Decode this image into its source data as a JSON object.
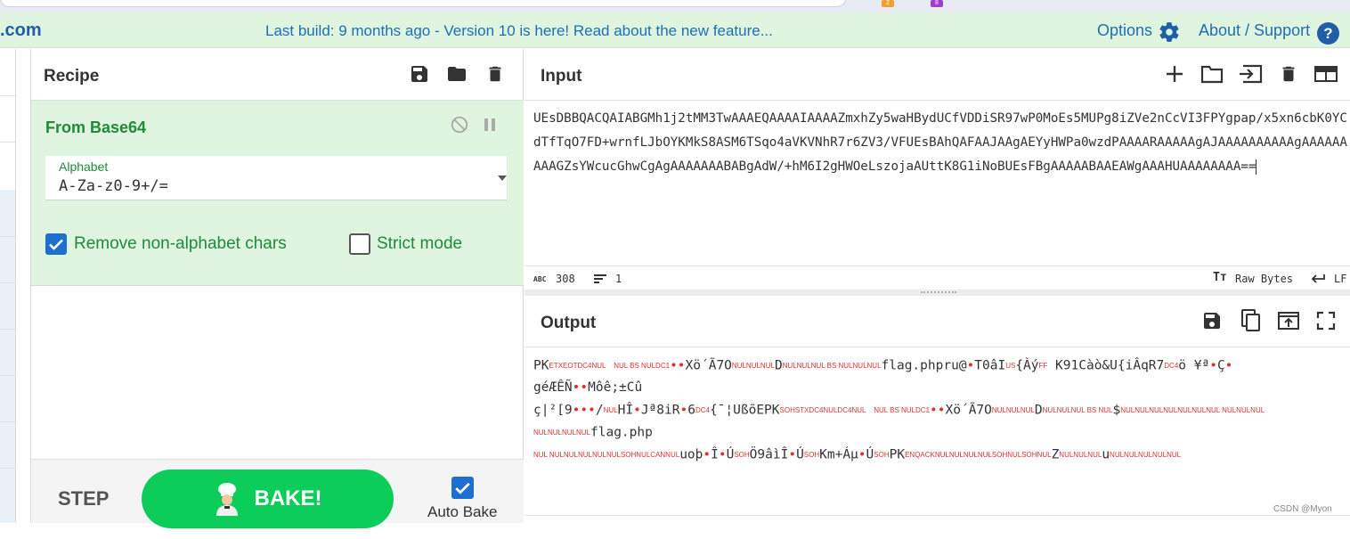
{
  "banner": {
    "site": ".com",
    "notice": "Last build: 9 months ago - Version 10 is here! Read about the new feature...",
    "options_label": "Options",
    "about_label": "About / Support",
    "help_glyph": "?"
  },
  "browser": {
    "ext1_badge": "2",
    "ext2_badge": "8"
  },
  "recipe": {
    "title": "Recipe",
    "operation": {
      "name": "From Base64",
      "alphabet_label": "Alphabet",
      "alphabet_value": "A-Za-z0-9+/=",
      "remove_non_alpha_label": "Remove non-alphabet chars",
      "remove_non_alpha_checked": true,
      "strict_mode_label": "Strict mode",
      "strict_mode_checked": false
    },
    "step_label": "STEP",
    "bake_label": "BAKE!",
    "autobake_label": "Auto Bake",
    "autobake_checked": true
  },
  "input": {
    "title": "Input",
    "text": "UEsDBBQACQAIABGMh1j2tMM3TwAAAEQAAAAIAAAAZmxhZy5waHBydUCfVDDiSR97wP0MoEs5MUPg8iZVe2nCcVI3FPYgpap/x5xn6cbK0YCdTfTqO7FD+wrnfLJbOYKMkS8ASM6TSqo4aVKVNhR7r6ZV3/VFUEsBAhQAFAAJAAgAEYyHWPa0wzdPAAAARAAAAAgAJAAAAAAAAAAgAAAAAAAAAGZsYWcucGhwCgAgAAAAAAABABgAdW/+hM6I2gHWOeLszojaAUttK8G1iNoBUEsFBgAAAAABAAEAWgAAAHUAAAAAAAA==",
    "char_count": "308",
    "line_count": "1",
    "format_label": "Raw Bytes",
    "eol_label": "LF"
  },
  "output": {
    "title": "Output",
    "lines": [
      [
        [
          "t",
          "PK"
        ],
        [
          "c",
          "ETXEOTDC4NUL"
        ],
        [
          "t",
          "  "
        ],
        [
          "c",
          "NUL BS NULDC1"
        ],
        [
          "d",
          "••"
        ],
        [
          "t",
          "Xö´Ã7O"
        ],
        [
          "c",
          "NULNULNUL"
        ],
        [
          "t",
          "D"
        ],
        [
          "c",
          "NULNULNUL BS NULNULNUL"
        ],
        [
          "t",
          "flag.phpru@"
        ],
        [
          "d",
          "•"
        ],
        [
          "t",
          "T0âI"
        ],
        [
          "c",
          "US"
        ],
        [
          "t",
          "{Àý"
        ],
        [
          "c",
          "FF"
        ],
        [
          "t",
          " K91Càò&U{iÂqR7"
        ],
        [
          "c",
          "DC4"
        ],
        [
          "t",
          "ö ¥ª"
        ],
        [
          "d",
          "•"
        ],
        [
          "t",
          "Ç"
        ],
        [
          "d",
          "•"
        ]
      ],
      [
        [
          "t",
          "géÆÊÑ"
        ],
        [
          "d",
          "••"
        ],
        [
          "t",
          "Môê;±Cû"
        ]
      ],
      [
        [
          "t",
          "ç|²[9"
        ],
        [
          "d",
          "•••"
        ],
        [
          "t",
          "/"
        ],
        [
          "c",
          "NUL"
        ],
        [
          "t",
          "HÎ"
        ],
        [
          "d",
          "•"
        ],
        [
          "t",
          "Jª8iR"
        ],
        [
          "d",
          "•"
        ],
        [
          "t",
          "6"
        ],
        [
          "c",
          "DC4"
        ],
        [
          "t",
          "{¯¦UßõEPK"
        ],
        [
          "c",
          "SOHSTXDC4NULDC4NUL"
        ],
        [
          "t",
          "  "
        ],
        [
          "c",
          "NUL BS NULDC1"
        ],
        [
          "d",
          "••"
        ],
        [
          "t",
          "Xö´Ã7O"
        ],
        [
          "c",
          "NULNULNUL"
        ],
        [
          "t",
          "D"
        ],
        [
          "c",
          "NULNULNUL BS NUL"
        ],
        [
          "t",
          "$"
        ],
        [
          "c",
          "NULNULNULNULNULNULNUL  NULNULNUL"
        ]
      ],
      [
        [
          "c",
          "NULNULNULNUL"
        ],
        [
          "t",
          "flag.php"
        ]
      ],
      [
        [
          "c",
          "NUL  NULNULNULNULNULSOHNULCANNUL"
        ],
        [
          "t",
          "uoþ"
        ],
        [
          "d",
          "•"
        ],
        [
          "t",
          "Î"
        ],
        [
          "d",
          "•"
        ],
        [
          "t",
          "Ú"
        ],
        [
          "c",
          "SOH"
        ],
        [
          "t",
          "Ö9âìÎ"
        ],
        [
          "d",
          "•"
        ],
        [
          "t",
          "Ú"
        ],
        [
          "c",
          "SOH"
        ],
        [
          "t",
          "Km+Áµ"
        ],
        [
          "d",
          "•"
        ],
        [
          "t",
          "Ú"
        ],
        [
          "c",
          "SOH"
        ],
        [
          "t",
          "PK"
        ],
        [
          "c",
          "ENQACKNULNULNULNULSOHNULSOHNUL"
        ],
        [
          "t",
          "Z"
        ],
        [
          "c",
          "NULNULNUL"
        ],
        [
          "t",
          "u"
        ],
        [
          "c",
          "NULNULNULNULNUL"
        ]
      ]
    ]
  },
  "watermark": "CSDN @Myon⁠"
}
